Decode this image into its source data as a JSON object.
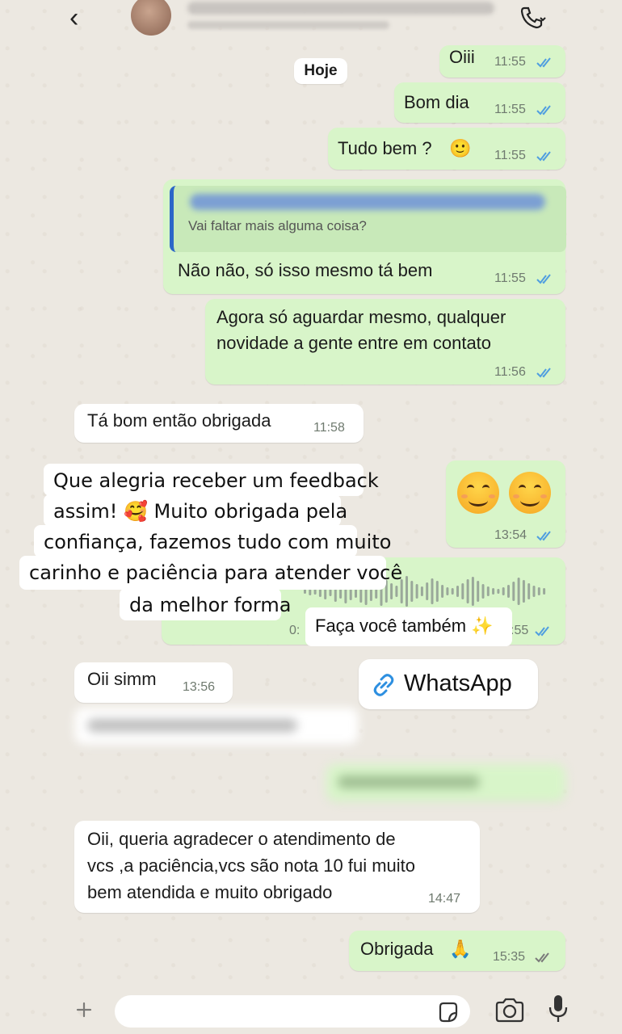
{
  "chat_header": {
    "back_glyph": "‹",
    "contact_name": "",
    "contact_status": ""
  },
  "date_pill": "Hoje",
  "messages": [
    {
      "text": "Oiii",
      "time": "11:55"
    },
    {
      "text": "Bom dia",
      "time": "11:55"
    },
    {
      "text": "Tudo bem ?",
      "emoji": "🙂",
      "time": "11:55"
    },
    {
      "quote_text": "Vai faltar mais alguma coisa?",
      "text": "Não não, só isso mesmo tá bem",
      "time": "11:55"
    },
    {
      "lines": [
        "Agora só aguardar mesmo, qualquer",
        "novidade a gente entre em contato"
      ],
      "time": "11:56"
    },
    {
      "text": "Tá bom então obrigada",
      "time": "11:58"
    },
    {
      "emoji": "😊 😊",
      "time": "13:54"
    },
    {
      "audio_time_partial": "0:",
      "time_partial": ":55"
    },
    {
      "text": "Oii simm",
      "time": "13:56"
    },
    {
      "lines": [
        "Oii, queria agradecer o atendimento de",
        "vcs ,a paciência,vcs são nota 10 fui muito",
        "bem atendida e muito obrigado"
      ],
      "time": "14:47"
    },
    {
      "text": "Obrigada",
      "emoji": "🙏",
      "time": "15:35"
    }
  ],
  "story_overlay": {
    "lines": [
      "Que alegria receber um feedback",
      "assim! 🥰 Muito obrigada pela",
      "confiança, fazemos tudo com muito",
      "carinho e paciência para atender você",
      "da melhor forma"
    ],
    "cta": "Faça você também ✨",
    "link_label": "WhatsApp"
  },
  "colors": {
    "outgoing_bubble": "#d8f5c9",
    "incoming_bubble": "#ffffff",
    "read_ticks": "#4f9ee0",
    "background": "#ece8e1"
  },
  "icons": [
    "back-icon",
    "phone-call-icon",
    "read-receipt-icon",
    "link-icon",
    "sticker-icon",
    "camera-icon",
    "microphone-icon",
    "attach-plus-icon"
  ]
}
